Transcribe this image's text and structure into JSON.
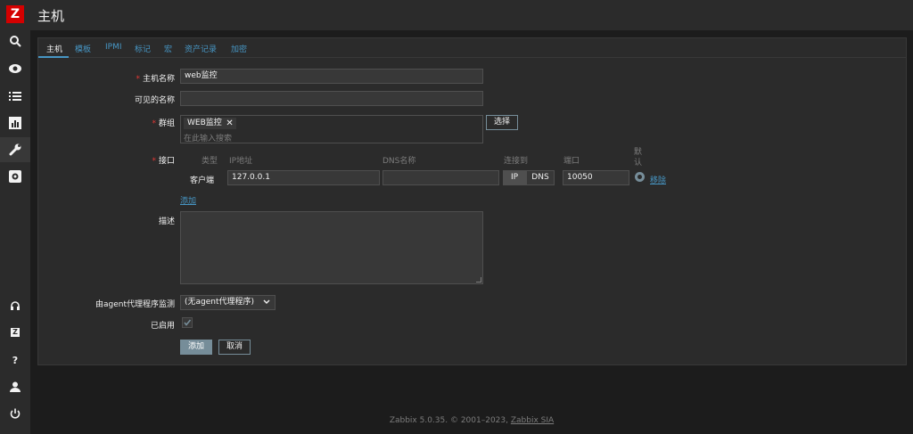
{
  "app": {
    "logo_letter": "Z",
    "page_title": "主机"
  },
  "sidebar": {
    "items": [
      {
        "icon": "search-icon"
      },
      {
        "icon": "eye-icon"
      },
      {
        "icon": "list-icon"
      },
      {
        "icon": "bar-chart-icon"
      },
      {
        "icon": "wrench-icon",
        "active": true
      },
      {
        "icon": "gear-icon"
      }
    ],
    "bottom_items": [
      {
        "icon": "headset-icon"
      },
      {
        "icon": "zabbix-share-icon",
        "glyph": "Z"
      },
      {
        "icon": "help-icon",
        "glyph": "?"
      },
      {
        "icon": "user-icon"
      },
      {
        "icon": "power-icon"
      }
    ]
  },
  "tabs": [
    {
      "label": "主机",
      "active": true
    },
    {
      "label": "模板"
    },
    {
      "label": "IPMI"
    },
    {
      "label": "标记"
    },
    {
      "label": "宏"
    },
    {
      "label": "资产记录"
    },
    {
      "label": "加密"
    }
  ],
  "form": {
    "host_name": {
      "label": "主机名称",
      "value": "web监控"
    },
    "visible_name": {
      "label": "可见的名称",
      "value": ""
    },
    "groups": {
      "label": "群组",
      "chips": [
        "WEB监控"
      ],
      "placeholder": "在此输入搜索",
      "select_button": "选择"
    },
    "interfaces": {
      "label": "接口",
      "headers": {
        "type": "类型",
        "ip": "IP地址",
        "dns": "DNS名称",
        "connect_to": "连接到",
        "port": "端口",
        "default": "默认"
      },
      "rows": [
        {
          "type": "客户端",
          "ip": "127.0.0.1",
          "dns": "",
          "connect_ip": "IP",
          "connect_dns": "DNS",
          "port": "10050",
          "remove": "移除"
        }
      ],
      "add_link": "添加"
    },
    "description": {
      "label": "描述",
      "value": ""
    },
    "proxy": {
      "label": "由agent代理程序监测",
      "selected": "(无agent代理程序)"
    },
    "enabled": {
      "label": "已启用",
      "checked": true
    },
    "buttons": {
      "add": "添加",
      "cancel": "取消"
    }
  },
  "footer": {
    "text": "Zabbix 5.0.35. © 2001–2023, ",
    "link": "Zabbix SIA"
  },
  "colors": {
    "accent": "#4796c4",
    "logo": "#d40000",
    "required": "#e33734",
    "button": "#768d99"
  }
}
